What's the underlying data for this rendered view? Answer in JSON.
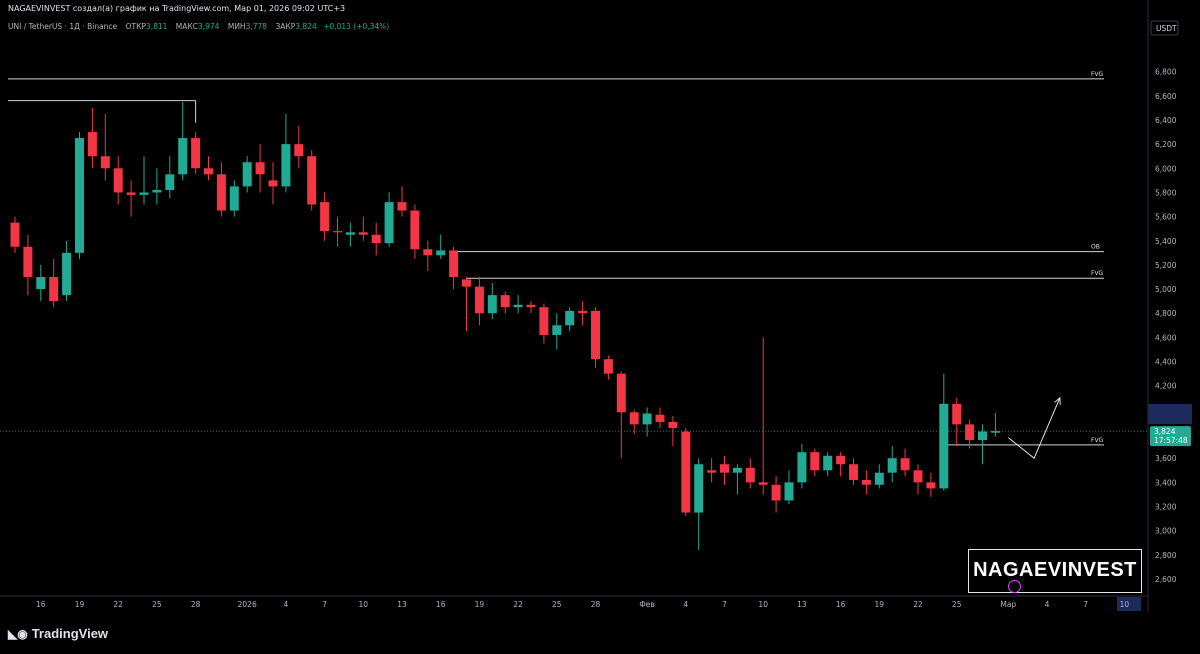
{
  "header": {
    "title": "NAGAEVINVEST создал(а) график на TradingView.com, Мар 01, 2026 09:02 UTC+3"
  },
  "legend": {
    "symbol": "UNI / TetherUS · 1Д · Binance",
    "open_label": "ОТКР",
    "open": "3,811",
    "high_label": "МАКС",
    "high": "3,974",
    "low_label": "МИН",
    "low": "3,778",
    "close_label": "ЗАКР",
    "close": "3,824",
    "change": "+0,013 (+0,34%)"
  },
  "currency": "USDT",
  "price_label": {
    "value": "3,824",
    "countdown": "17:57:48"
  },
  "brand": "NAGAEVINVEST",
  "footer": {
    "logo_text": "TradingView"
  },
  "colors": {
    "up": "#22ab94",
    "down": "#f23645",
    "background": "#000000",
    "level": "#d1d4dc"
  },
  "chart_data": {
    "type": "candlestick",
    "y_ticks": [
      "2,600",
      "2,800",
      "3,000",
      "3,200",
      "3,400",
      "3,600",
      "3,800",
      "4,000",
      "4,200",
      "4,400",
      "4,600",
      "4,800",
      "5,000",
      "5,200",
      "5,400",
      "5,600",
      "5,800",
      "6,000",
      "6,200",
      "6,400",
      "6,600",
      "6,800"
    ],
    "ylim": [
      2.46,
      6.9
    ],
    "x_ticks": [
      {
        "label": "16",
        "i": 2
      },
      {
        "label": "19",
        "i": 5
      },
      {
        "label": "22",
        "i": 8
      },
      {
        "label": "25",
        "i": 11
      },
      {
        "label": "28",
        "i": 14
      },
      {
        "label": "2026",
        "i": 18
      },
      {
        "label": "4",
        "i": 21
      },
      {
        "label": "7",
        "i": 24
      },
      {
        "label": "10",
        "i": 27
      },
      {
        "label": "13",
        "i": 30
      },
      {
        "label": "16",
        "i": 33
      },
      {
        "label": "19",
        "i": 36
      },
      {
        "label": "22",
        "i": 39
      },
      {
        "label": "25",
        "i": 42
      },
      {
        "label": "28",
        "i": 45
      },
      {
        "label": "Фев",
        "i": 49
      },
      {
        "label": "4",
        "i": 52
      },
      {
        "label": "7",
        "i": 55
      },
      {
        "label": "10",
        "i": 58
      },
      {
        "label": "13",
        "i": 61
      },
      {
        "label": "16",
        "i": 64
      },
      {
        "label": "19",
        "i": 67
      },
      {
        "label": "22",
        "i": 70
      },
      {
        "label": "25",
        "i": 73
      },
      {
        "label": "Мар",
        "i": 77
      },
      {
        "label": "4",
        "i": 80
      },
      {
        "label": "7",
        "i": 83
      },
      {
        "label": "10",
        "i": 86
      }
    ],
    "candles": [
      [
        5.55,
        5.35,
        5.6,
        5.3
      ],
      [
        5.35,
        5.1,
        5.45,
        4.95
      ],
      [
        5.0,
        5.1,
        5.2,
        4.9
      ],
      [
        5.1,
        4.9,
        5.25,
        4.85
      ],
      [
        4.95,
        5.3,
        5.4,
        4.9
      ],
      [
        5.3,
        6.25,
        6.3,
        5.25
      ],
      [
        6.3,
        6.1,
        6.5,
        6.0
      ],
      [
        6.1,
        6.0,
        6.45,
        5.9
      ],
      [
        6.0,
        5.8,
        6.1,
        5.7
      ],
      [
        5.8,
        5.78,
        5.9,
        5.6
      ],
      [
        5.78,
        5.8,
        6.1,
        5.7
      ],
      [
        5.8,
        5.82,
        6.0,
        5.7
      ],
      [
        5.82,
        5.95,
        6.1,
        5.75
      ],
      [
        5.95,
        6.25,
        6.55,
        5.9
      ],
      [
        6.25,
        6.0,
        6.3,
        5.95
      ],
      [
        6.0,
        5.95,
        6.1,
        5.9
      ],
      [
        5.95,
        5.65,
        6.05,
        5.6
      ],
      [
        5.65,
        5.85,
        5.9,
        5.6
      ],
      [
        5.85,
        6.05,
        6.1,
        5.8
      ],
      [
        6.05,
        5.95,
        6.2,
        5.8
      ],
      [
        5.9,
        5.85,
        6.05,
        5.7
      ],
      [
        5.85,
        6.2,
        6.45,
        5.8
      ],
      [
        6.2,
        6.1,
        6.35,
        6.0
      ],
      [
        6.1,
        5.7,
        6.15,
        5.65
      ],
      [
        5.72,
        5.48,
        5.8,
        5.4
      ],
      [
        5.48,
        5.47,
        5.6,
        5.35
      ],
      [
        5.45,
        5.47,
        5.55,
        5.35
      ],
      [
        5.47,
        5.45,
        5.6,
        5.4
      ],
      [
        5.45,
        5.38,
        5.55,
        5.28
      ],
      [
        5.38,
        5.72,
        5.8,
        5.35
      ],
      [
        5.72,
        5.65,
        5.85,
        5.6
      ],
      [
        5.65,
        5.33,
        5.7,
        5.25
      ],
      [
        5.33,
        5.28,
        5.4,
        5.15
      ],
      [
        5.28,
        5.32,
        5.45,
        5.25
      ],
      [
        5.32,
        5.1,
        5.35,
        5.0
      ],
      [
        5.08,
        5.02,
        5.1,
        4.65
      ],
      [
        5.02,
        4.8,
        5.1,
        4.7
      ],
      [
        4.8,
        4.95,
        5.05,
        4.75
      ],
      [
        4.95,
        4.85,
        4.98,
        4.8
      ],
      [
        4.85,
        4.87,
        4.95,
        4.8
      ],
      [
        4.87,
        4.85,
        4.9,
        4.8
      ],
      [
        4.85,
        4.62,
        4.88,
        4.55
      ],
      [
        4.62,
        4.7,
        4.8,
        4.5
      ],
      [
        4.7,
        4.82,
        4.85,
        4.65
      ],
      [
        4.82,
        4.8,
        4.9,
        4.7
      ],
      [
        4.82,
        4.42,
        4.85,
        4.35
      ],
      [
        4.42,
        4.3,
        4.45,
        4.25
      ],
      [
        4.3,
        3.98,
        4.32,
        3.6
      ],
      [
        3.98,
        3.88,
        4.0,
        3.8
      ],
      [
        3.88,
        3.97,
        4.02,
        3.78
      ],
      [
        3.96,
        3.9,
        4.02,
        3.85
      ],
      [
        3.9,
        3.85,
        3.95,
        3.7
      ],
      [
        3.82,
        3.15,
        3.85,
        3.12
      ],
      [
        3.15,
        3.55,
        3.6,
        2.84
      ],
      [
        3.5,
        3.48,
        3.6,
        3.4
      ],
      [
        3.55,
        3.48,
        3.62,
        3.38
      ],
      [
        3.48,
        3.52,
        3.55,
        3.3
      ],
      [
        3.52,
        3.4,
        3.6,
        3.35
      ],
      [
        3.4,
        3.38,
        4.6,
        3.3
      ],
      [
        3.38,
        3.25,
        3.45,
        3.15
      ],
      [
        3.25,
        3.4,
        3.5,
        3.22
      ],
      [
        3.4,
        3.65,
        3.72,
        3.35
      ],
      [
        3.65,
        3.5,
        3.68,
        3.45
      ],
      [
        3.5,
        3.62,
        3.65,
        3.45
      ],
      [
        3.62,
        3.55,
        3.65,
        3.45
      ],
      [
        3.55,
        3.42,
        3.6,
        3.38
      ],
      [
        3.42,
        3.38,
        3.5,
        3.3
      ],
      [
        3.38,
        3.48,
        3.55,
        3.35
      ],
      [
        3.48,
        3.6,
        3.7,
        3.4
      ],
      [
        3.6,
        3.5,
        3.68,
        3.45
      ],
      [
        3.5,
        3.4,
        3.55,
        3.3
      ],
      [
        3.4,
        3.35,
        3.48,
        3.28
      ],
      [
        3.35,
        4.05,
        4.3,
        3.33
      ],
      [
        4.05,
        3.88,
        4.1,
        3.7
      ],
      [
        3.88,
        3.75,
        3.92,
        3.68
      ],
      [
        3.75,
        3.82,
        3.88,
        3.55
      ],
      [
        3.811,
        3.824,
        3.974,
        3.778
      ]
    ],
    "levels": [
      {
        "label": "FVG",
        "price": 6.74,
        "from_i": -1
      },
      {
        "label": "",
        "price": 6.56,
        "from_i": -1,
        "to_i": 14
      },
      {
        "label": "OB",
        "price": 5.31,
        "from_i": 34
      },
      {
        "label": "FVG",
        "price": 5.09,
        "from_i": 35
      },
      {
        "label": "FVG",
        "price": 3.71,
        "from_i": 72
      }
    ],
    "projection": [
      [
        77,
        3.77
      ],
      [
        79,
        3.6
      ],
      [
        81,
        4.1
      ]
    ]
  }
}
